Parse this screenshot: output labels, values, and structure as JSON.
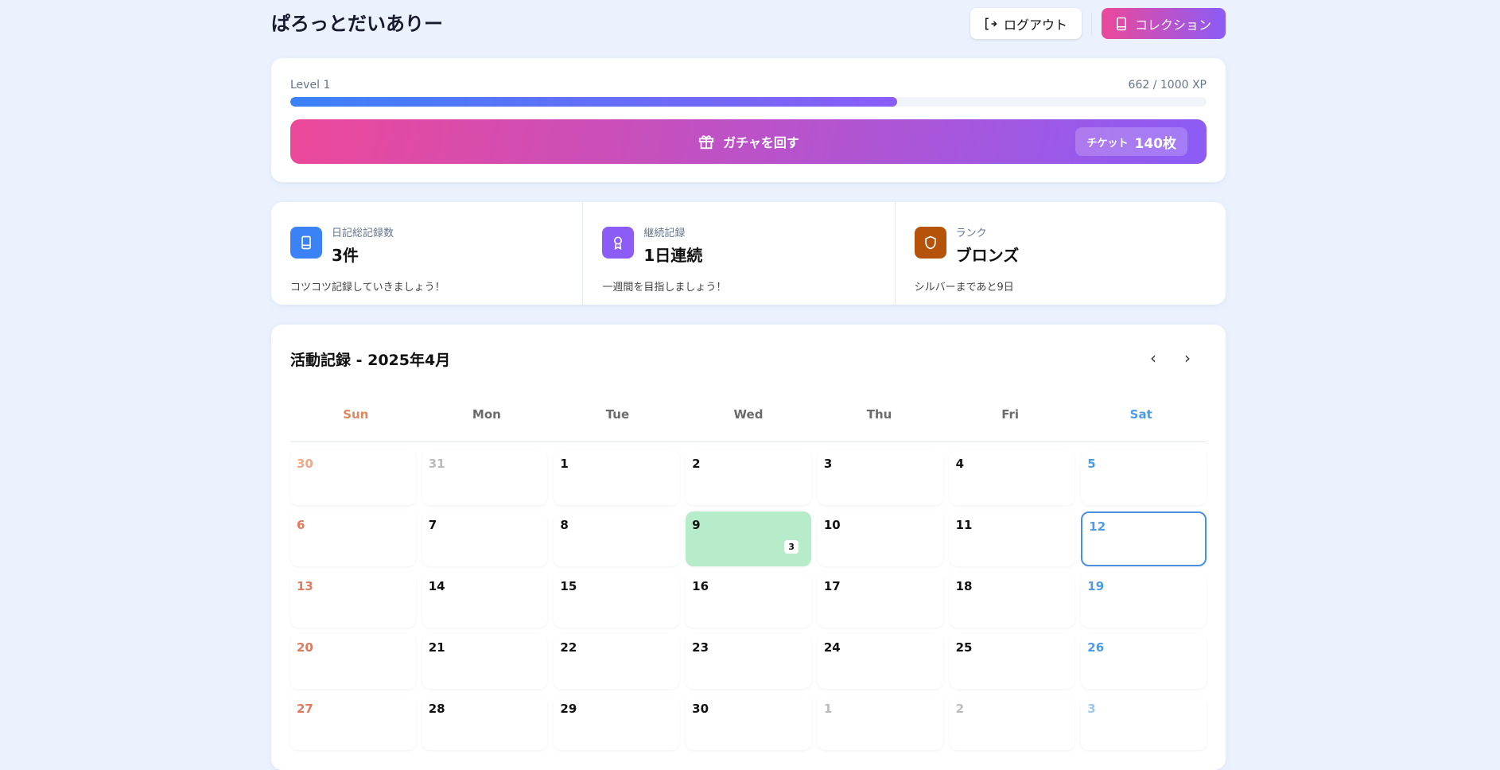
{
  "header": {
    "title": "ぱろっとだいありー",
    "logout": "ログアウト",
    "collection": "コレクション"
  },
  "level": {
    "label": "Level 1",
    "xp": "662 / 1000 XP",
    "progress": 0.662,
    "gacha": "ガチャを回す",
    "ticket_label": "チケット",
    "ticket_count": "140枚"
  },
  "stats": [
    {
      "label": "日記総記録数",
      "value": "3件",
      "sub": "コツコツ記録していきましょう！",
      "icon": "book-icon",
      "color": "#3b82f6"
    },
    {
      "label": "継続記録",
      "value": "1日連続",
      "sub": "一週間を目指しましょう！",
      "icon": "award-icon",
      "color": "#8b5cf6"
    },
    {
      "label": "ランク",
      "value": "ブロンズ",
      "sub": "シルバーまであと9日",
      "icon": "shield-icon",
      "color": "#b45309"
    }
  ],
  "calendar": {
    "title": "活動記録 - 2025年4月",
    "prev": "‹",
    "next": "›",
    "weekdays": [
      "Sun",
      "Mon",
      "Tue",
      "Wed",
      "Thu",
      "Fri",
      "Sat"
    ],
    "days": [
      {
        "d": "30",
        "o": 1
      },
      {
        "d": "31",
        "o": 1
      },
      {
        "d": "1"
      },
      {
        "d": "2"
      },
      {
        "d": "3"
      },
      {
        "d": "4"
      },
      {
        "d": "5"
      },
      {
        "d": "6"
      },
      {
        "d": "7"
      },
      {
        "d": "8"
      },
      {
        "d": "9",
        "count": "3"
      },
      {
        "d": "10"
      },
      {
        "d": "11"
      },
      {
        "d": "12",
        "today": 1
      },
      {
        "d": "13"
      },
      {
        "d": "14"
      },
      {
        "d": "15"
      },
      {
        "d": "16"
      },
      {
        "d": "17"
      },
      {
        "d": "18"
      },
      {
        "d": "19"
      },
      {
        "d": "20"
      },
      {
        "d": "21"
      },
      {
        "d": "22"
      },
      {
        "d": "23"
      },
      {
        "d": "24"
      },
      {
        "d": "25"
      },
      {
        "d": "26"
      },
      {
        "d": "27"
      },
      {
        "d": "28"
      },
      {
        "d": "29"
      },
      {
        "d": "30"
      },
      {
        "d": "1",
        "o": 1
      },
      {
        "d": "2",
        "o": 1
      },
      {
        "d": "3",
        "o": 1
      }
    ]
  }
}
